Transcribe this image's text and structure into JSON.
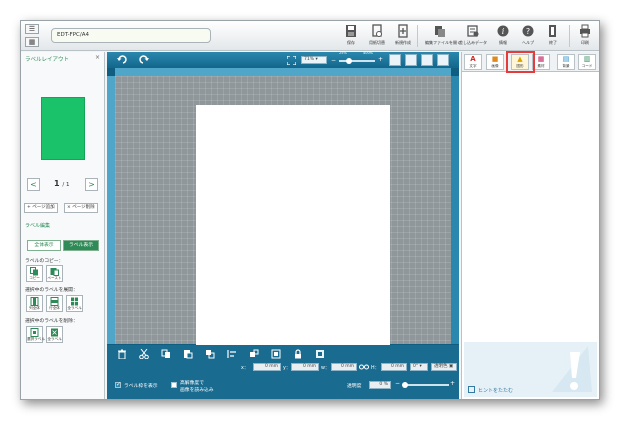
{
  "app": {
    "file_name": "EDT-FPC/A4"
  },
  "toolbar": {
    "items": [
      {
        "label": "保存",
        "icon": "save-icon"
      },
      {
        "label": "用紙切替",
        "icon": "paper-switch-icon"
      },
      {
        "label": "新規作成",
        "icon": "new-file-icon"
      },
      {
        "label": "編集ファイルを開く",
        "icon": "open-file-icon"
      },
      {
        "label": "差し込みデータ",
        "icon": "merge-data-icon"
      },
      {
        "label": "情報",
        "icon": "info-icon"
      },
      {
        "label": "ヘルプ",
        "icon": "help-icon"
      },
      {
        "label": "終了",
        "icon": "exit-icon"
      },
      {
        "label": "印刷",
        "icon": "print-icon"
      }
    ]
  },
  "left_panel": {
    "title": "ラベルレイアウト",
    "close": "×",
    "page_current": "1",
    "page_total": "/ 1",
    "prev": "<",
    "next": ">",
    "add_page": "ページ追加",
    "delete_page": "ページ削除",
    "label_edit_title": "ラベル編集",
    "show_all": "全体表示",
    "show_label": "ラベル表示",
    "copy_title": "ラベルのコピー：",
    "copy": "コピー",
    "paste": "ペースト",
    "copy_selected_title": "選択中のラベルを展開：",
    "expand_buttons": [
      "列全体",
      "行全体",
      "全ラベル"
    ],
    "delete_selected_title": "選択中のラベルを削除：",
    "delete_buttons": [
      "選択ラベル",
      "全ラベル"
    ]
  },
  "editor": {
    "zoom": "71%",
    "zoom_min": "25%",
    "zoom_max": "400%",
    "zoom_fraction": 0.22,
    "x_label": "x：",
    "x_value": "0 mm",
    "y_label": "y：",
    "y_value": "0 mm",
    "w_label": "w：",
    "w_value": "0 mm",
    "h_label": "H：",
    "h_value": "0 mm",
    "rotation": "0°",
    "transparent_color": "透明色",
    "show_label_frame": "ラベル枠を表示",
    "load_image_line1": "高解像度で",
    "load_image_line2": "画像を読み込み",
    "opacity_label": "透明度",
    "opacity_value": "0 %"
  },
  "right_panel": {
    "tabs": [
      {
        "glyph": "A",
        "label": "文字",
        "color": "#d62828"
      },
      {
        "glyph": "■",
        "label": "画像",
        "color": "#e08a1e"
      },
      {
        "glyph": "▲",
        "label": "図形",
        "color": "#d9a400"
      },
      {
        "glyph": "▦",
        "label": "素材",
        "color": "#c2185b"
      },
      {
        "glyph": "▤",
        "label": "背景",
        "color": "#1e88c8"
      },
      {
        "glyph": "▥",
        "label": "コード",
        "color": "#2e8b57"
      }
    ],
    "hint_toggle": "ヒントをたたむ"
  }
}
